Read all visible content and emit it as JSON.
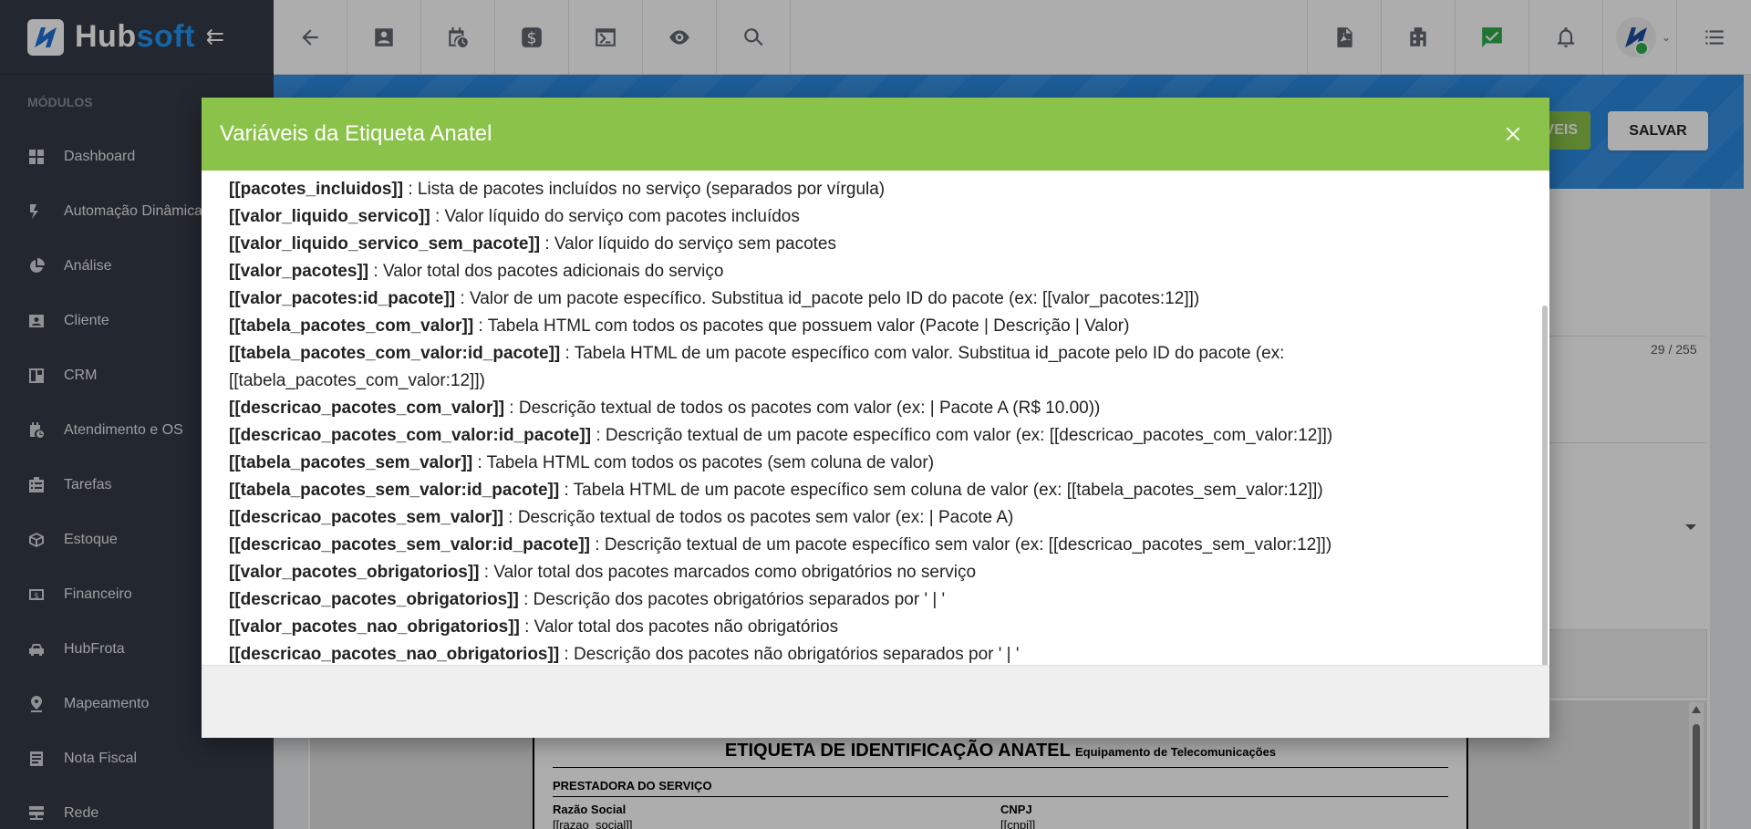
{
  "brand": {
    "name_part1": "Hub",
    "name_part2": "soft"
  },
  "sidebar": {
    "title": "MÓDULOS",
    "items": [
      {
        "label": "Dashboard"
      },
      {
        "label": "Automação Dinâmica"
      },
      {
        "label": "Análise"
      },
      {
        "label": "Cliente"
      },
      {
        "label": "CRM"
      },
      {
        "label": "Atendimento e OS"
      },
      {
        "label": "Tarefas"
      },
      {
        "label": "Estoque"
      },
      {
        "label": "Financeiro"
      },
      {
        "label": "HubFrota"
      },
      {
        "label": "Mapeamento"
      },
      {
        "label": "Nota Fiscal"
      },
      {
        "label": "Rede"
      }
    ]
  },
  "page": {
    "green_button_label": "VEIS",
    "save_label": "SALVAR",
    "counter": "29 / 255"
  },
  "label_preview": {
    "title": "ETIQUETA DE IDENTIFICAÇÃO ANATEL",
    "subtitle": "Equipamento de Telecomunicações",
    "section": "PRESTADORA DO SERVIÇO",
    "col1_label": "Razão Social",
    "col2_label": "CNPJ",
    "col1_value": "[[razao_social]]",
    "col2_value": "[[cnpj]]"
  },
  "modal": {
    "title": "Variáveis da Etiqueta Anatel",
    "lines": [
      {
        "var": "[[pacotes_incluidos]]",
        "desc": " : Lista de pacotes incluídos no serviço (separados por vírgula)"
      },
      {
        "var": "[[valor_liquido_servico]]",
        "desc": " : Valor líquido do serviço com pacotes incluídos"
      },
      {
        "var": "[[valor_liquido_servico_sem_pacote]]",
        "desc": " : Valor líquido do serviço sem pacotes"
      },
      {
        "var": "[[valor_pacotes]]",
        "desc": " : Valor total dos pacotes adicionais do serviço"
      },
      {
        "var": "[[valor_pacotes:id_pacote]]",
        "desc": " : Valor de um pacote específico. Substitua id_pacote pelo ID do pacote (ex: [[valor_pacotes:12]])"
      },
      {
        "var": "[[tabela_pacotes_com_valor]]",
        "desc": " : Tabela HTML com todos os pacotes que possuem valor (Pacote | Descrição | Valor)"
      },
      {
        "var": "[[tabela_pacotes_com_valor:id_pacote]]",
        "desc": " : Tabela HTML de um pacote específico com valor. Substitua id_pacote pelo ID do pacote (ex:"
      },
      {
        "var": "",
        "desc": "[[tabela_pacotes_com_valor:12]])"
      },
      {
        "var": "[[descricao_pacotes_com_valor]]",
        "desc": " : Descrição textual de todos os pacotes com valor (ex: | Pacote A (R$ 10.00))"
      },
      {
        "var": "[[descricao_pacotes_com_valor:id_pacote]]",
        "desc": " : Descrição textual de um pacote específico com valor (ex: [[descricao_pacotes_com_valor:12]])"
      },
      {
        "var": "[[tabela_pacotes_sem_valor]]",
        "desc": " : Tabela HTML com todos os pacotes (sem coluna de valor)"
      },
      {
        "var": "[[tabela_pacotes_sem_valor:id_pacote]]",
        "desc": " : Tabela HTML de um pacote específico sem coluna de valor (ex: [[tabela_pacotes_sem_valor:12]])"
      },
      {
        "var": "[[descricao_pacotes_sem_valor]]",
        "desc": " : Descrição textual de todos os pacotes sem valor (ex: | Pacote A)"
      },
      {
        "var": "[[descricao_pacotes_sem_valor:id_pacote]]",
        "desc": " : Descrição textual de um pacote específico sem valor (ex: [[descricao_pacotes_sem_valor:12]])"
      },
      {
        "var": "[[valor_pacotes_obrigatorios]]",
        "desc": " : Valor total dos pacotes marcados como obrigatórios no serviço"
      },
      {
        "var": "[[descricao_pacotes_obrigatorios]]",
        "desc": " : Descrição dos pacotes obrigatórios separados por ' | '"
      },
      {
        "var": "[[valor_pacotes_nao_obrigatorios]]",
        "desc": " : Valor total dos pacotes não obrigatórios"
      },
      {
        "var": "[[descricao_pacotes_nao_obrigatorios]]",
        "desc": " : Descrição dos pacotes não obrigatórios separados por ' | '"
      }
    ]
  },
  "colors": {
    "sidebar_bg": "#343a46",
    "header_blue": "#2a8ae0",
    "modal_green": "#8bc34a"
  }
}
